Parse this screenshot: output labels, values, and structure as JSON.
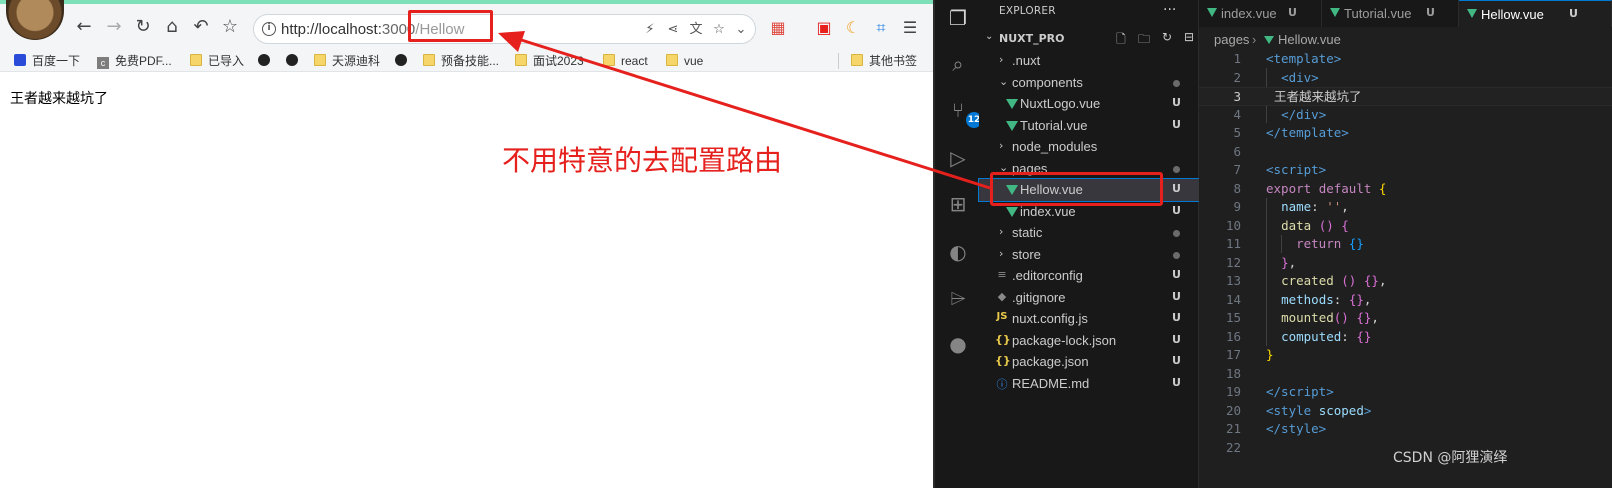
{
  "browser": {
    "url_scheme_host": "http://localhost:",
    "url_port": "3000",
    "url_path": "/Hellow",
    "bookmarks": [
      {
        "label": "百度一下",
        "icon": "paw-icon"
      },
      {
        "label": "免费PDF...",
        "icon": "c-icon"
      },
      {
        "label": "已导入",
        "icon": "folder-icon"
      },
      {
        "label": "",
        "icon": "globe-icon"
      },
      {
        "label": "",
        "icon": "globe-icon"
      },
      {
        "label": "天源迪科",
        "icon": "folder-icon"
      },
      {
        "label": "",
        "icon": "globe-icon"
      },
      {
        "label": "预备技能...",
        "icon": "folder-icon"
      },
      {
        "label": "面试2023",
        "icon": "folder-icon"
      },
      {
        "label": "react",
        "icon": "folder-icon"
      },
      {
        "label": "vue",
        "icon": "folder-icon"
      }
    ],
    "other_bookmarks": "其他书签",
    "page_text": "王者越来越坑了"
  },
  "vscode": {
    "explorer_title": "EXPLORER",
    "more": "···",
    "project": "NUXT_PRO",
    "scm_badge": "12",
    "tree": [
      {
        "label": ".nuxt",
        "type": "folder",
        "status": ""
      },
      {
        "label": "components",
        "type": "folder-open",
        "status": "dot"
      },
      {
        "label": "NuxtLogo.vue",
        "type": "vue",
        "status": "U"
      },
      {
        "label": "Tutorial.vue",
        "type": "vue",
        "status": "U"
      },
      {
        "label": "node_modules",
        "type": "folder",
        "status": ""
      },
      {
        "label": "pages",
        "type": "folder-open",
        "status": "dot"
      },
      {
        "label": "Hellow.vue",
        "type": "vue",
        "status": "U"
      },
      {
        "label": "index.vue",
        "type": "vue",
        "status": "U"
      },
      {
        "label": "static",
        "type": "folder",
        "status": "dot"
      },
      {
        "label": "store",
        "type": "folder",
        "status": "dot"
      },
      {
        "label": ".editorconfig",
        "type": "config",
        "status": "U"
      },
      {
        "label": ".gitignore",
        "type": "git",
        "status": "U"
      },
      {
        "label": "nuxt.config.js",
        "type": "js",
        "status": "U"
      },
      {
        "label": "package-lock.json",
        "type": "json",
        "status": "U"
      },
      {
        "label": "package.json",
        "type": "json",
        "status": "U"
      },
      {
        "label": "README.md",
        "type": "info",
        "status": "U"
      }
    ],
    "tabs": [
      {
        "label": "index.vue",
        "status": "U"
      },
      {
        "label": "Tutorial.vue",
        "status": "U"
      },
      {
        "label": "Hellow.vue",
        "status": "U"
      }
    ],
    "breadcrumbs": [
      "pages",
      "Hellow.vue"
    ],
    "line_numbers": [
      "1",
      "2",
      "3",
      "4",
      "5",
      "6",
      "7",
      "8",
      "9",
      "10",
      "11",
      "12",
      "13",
      "14",
      "15",
      "16",
      "17",
      "18",
      "19",
      "20",
      "21",
      "22"
    ]
  },
  "annotation": {
    "text": "不用特意的去配置路由",
    "color": "#e5201d"
  },
  "watermark": "CSDN @阿狸演绎"
}
